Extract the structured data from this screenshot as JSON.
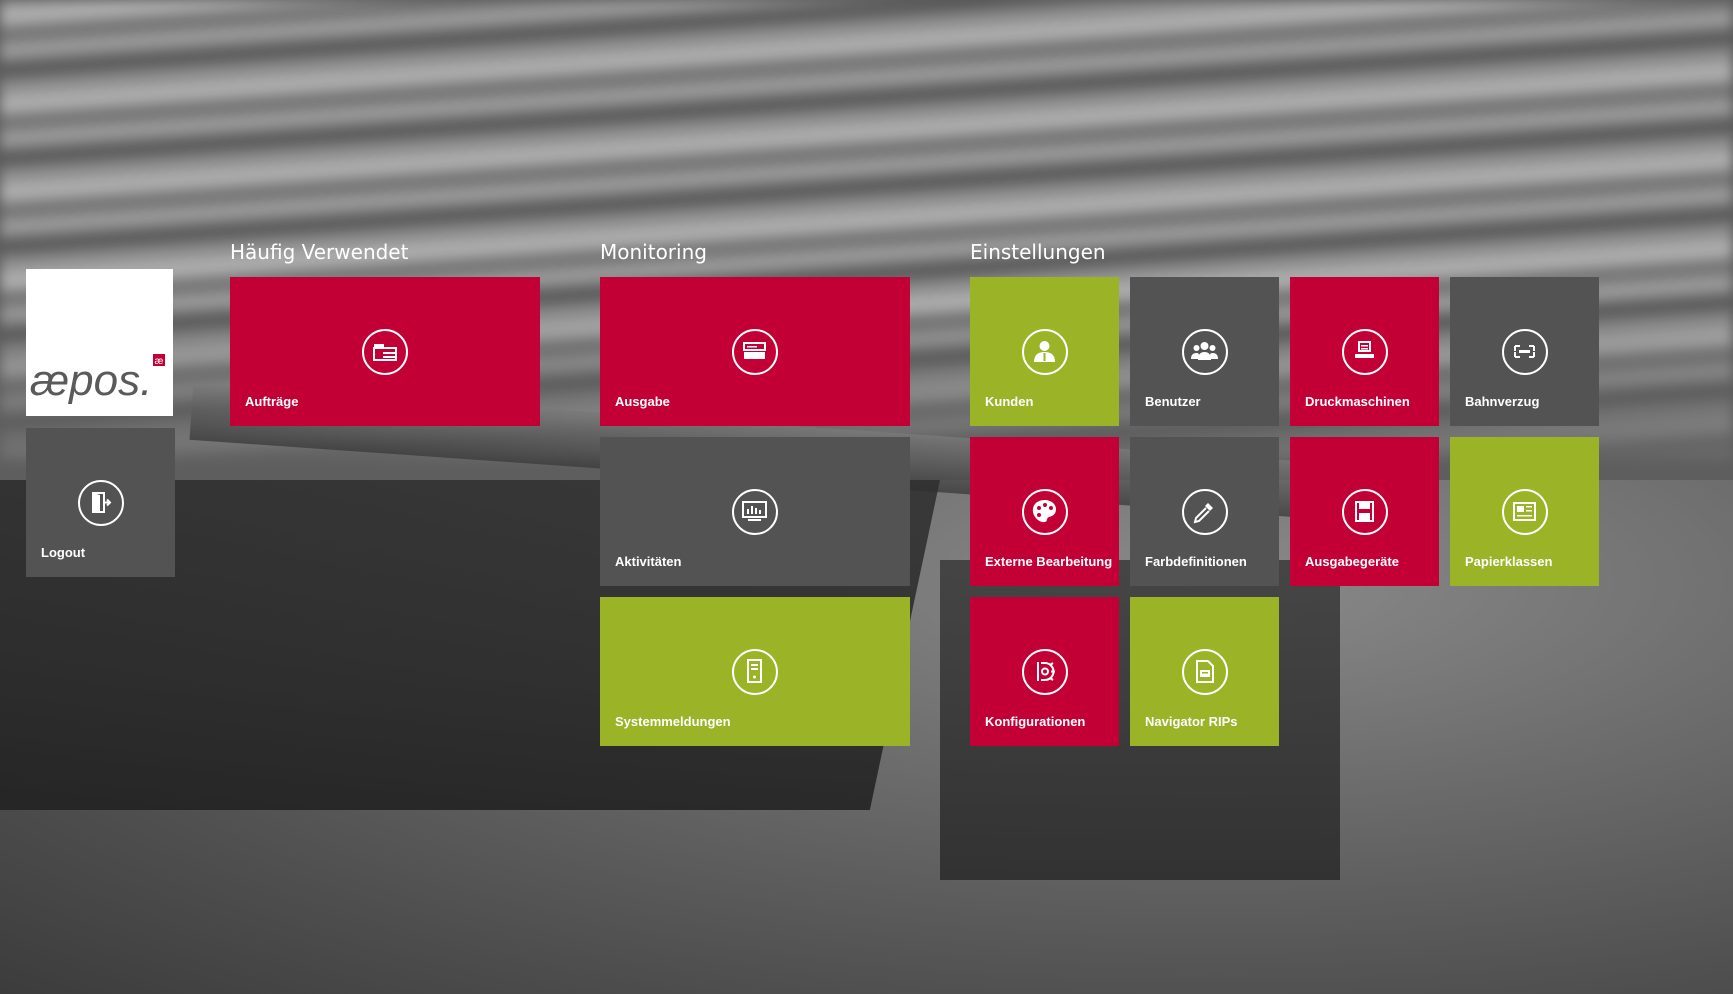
{
  "brand": {
    "logo_text": "æpos.",
    "logo_mark": "æ",
    "colors": {
      "red": "#c20036",
      "grey": "#535354",
      "green": "#9ab327"
    }
  },
  "sidebar": {
    "logout": {
      "label": "Logout",
      "icon": "logout-icon"
    }
  },
  "sections": {
    "frequent": {
      "title": "Häufig Verwendet",
      "tiles": [
        {
          "label": "Aufträge",
          "icon": "orders-icon",
          "color": "red"
        }
      ]
    },
    "monitoring": {
      "title": "Monitoring",
      "tiles": [
        {
          "label": "Ausgabe",
          "icon": "output-icon",
          "color": "red"
        },
        {
          "label": "Aktivitäten",
          "icon": "activity-monitor-icon",
          "color": "grey"
        },
        {
          "label": "Systemmeldungen",
          "icon": "system-messages-icon",
          "color": "green"
        }
      ]
    },
    "settings": {
      "title": "Einstellungen",
      "tiles": [
        {
          "label": "Kunden",
          "icon": "customer-icon",
          "color": "green"
        },
        {
          "label": "Benutzer",
          "icon": "users-icon",
          "color": "grey"
        },
        {
          "label": "Druckmaschinen",
          "icon": "printer-icon",
          "color": "red"
        },
        {
          "label": "Bahnverzug",
          "icon": "web-distortion-icon",
          "color": "grey"
        },
        {
          "label": "Externe Bearbeitung",
          "icon": "palette-icon",
          "color": "red"
        },
        {
          "label": "Farbdefinitionen",
          "icon": "eyedropper-icon",
          "color": "grey"
        },
        {
          "label": "Ausgabegeräte",
          "icon": "output-device-icon",
          "color": "red"
        },
        {
          "label": "Papierklassen",
          "icon": "paper-class-icon",
          "color": "green"
        },
        {
          "label": "Konfigurationen",
          "icon": "configuration-icon",
          "color": "red"
        },
        {
          "label": "Navigator RIPs",
          "icon": "rip-file-icon",
          "color": "green"
        }
      ]
    }
  }
}
